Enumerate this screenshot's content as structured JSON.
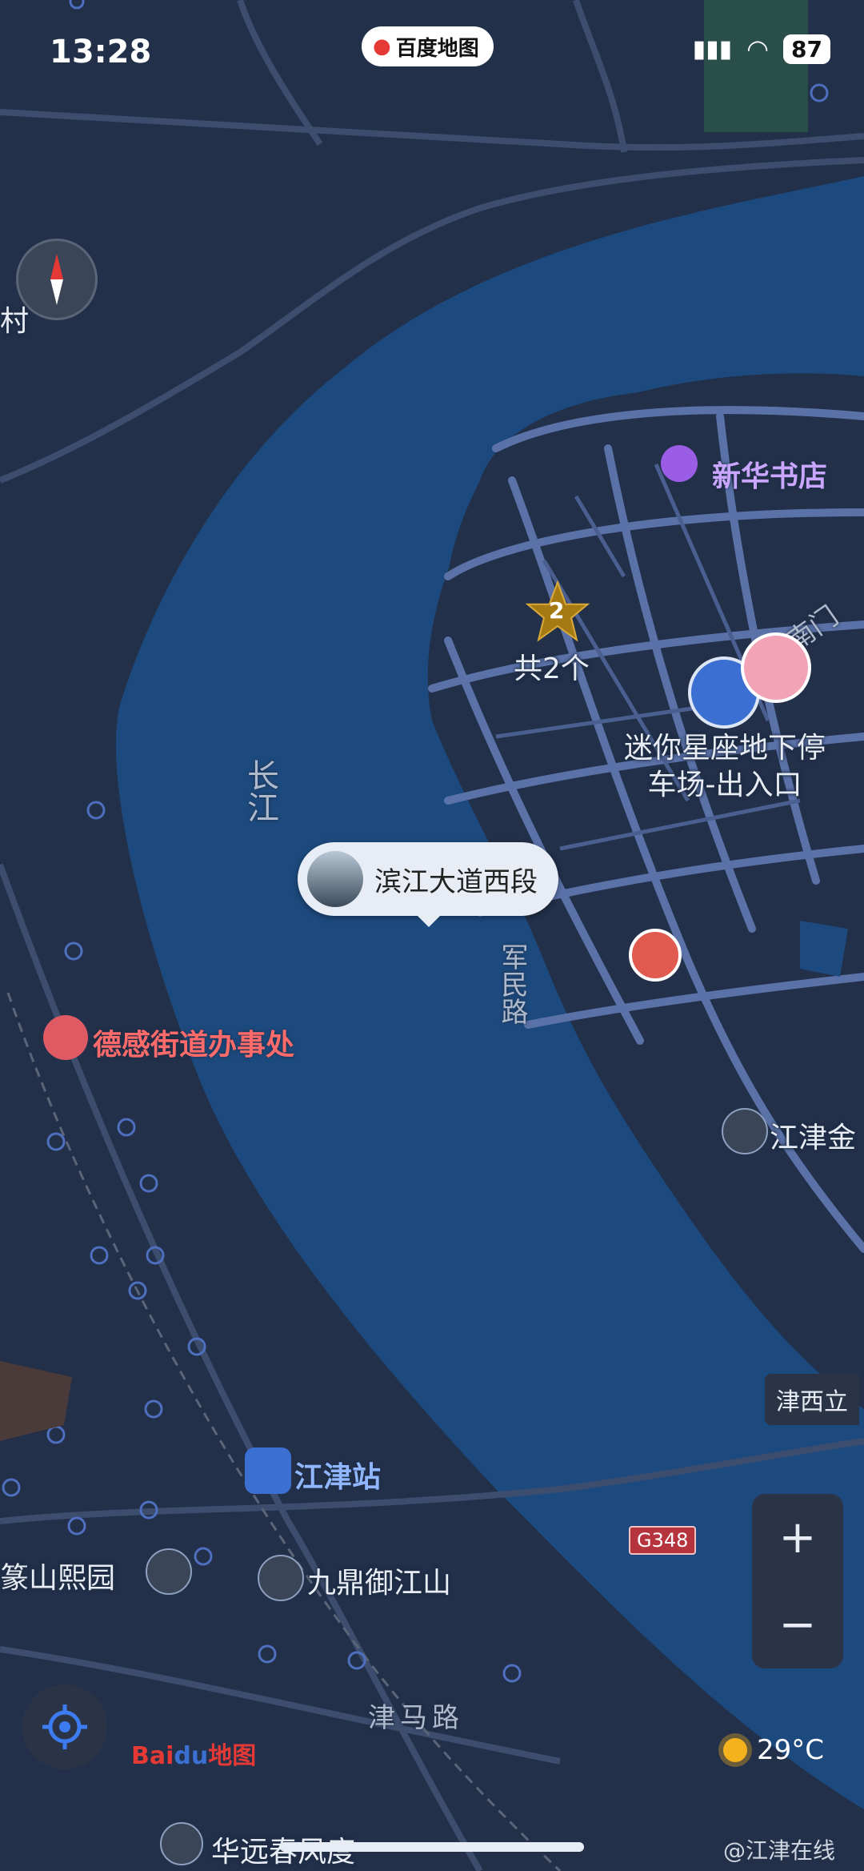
{
  "status_bar": {
    "time": "13:28",
    "battery": "87",
    "app_pill": "百度地图"
  },
  "map": {
    "labels": {
      "cun": "村",
      "xinhua": "新华书店",
      "cluster_count": "2",
      "cluster_label": "共2个",
      "nanmen": "南门",
      "parking": "迷你星座地下停\n车场-出入口",
      "changjiang": "长江",
      "junmin": "军民路",
      "degan": "德感街道办事处",
      "jiangjin_jin": "江津金",
      "jinxi": "津西立",
      "jiangjin_station": "江津站",
      "zhuanshan": "篆山熙园",
      "jiuding": "九鼎御江山",
      "jinma": "津马路",
      "huayuan": "华远春风度"
    },
    "callout": "滨江大道西段",
    "road_shield": "G348"
  },
  "controls": {
    "zoom_in": "+",
    "zoom_out": "−"
  },
  "weather": {
    "temp": "29°C"
  },
  "branding": {
    "logo_text": "Bai du 地图",
    "watermark": "@江津在线"
  },
  "colors": {
    "land": "#22304a",
    "river": "#1d4a7e",
    "roads": "#5b72a8"
  }
}
